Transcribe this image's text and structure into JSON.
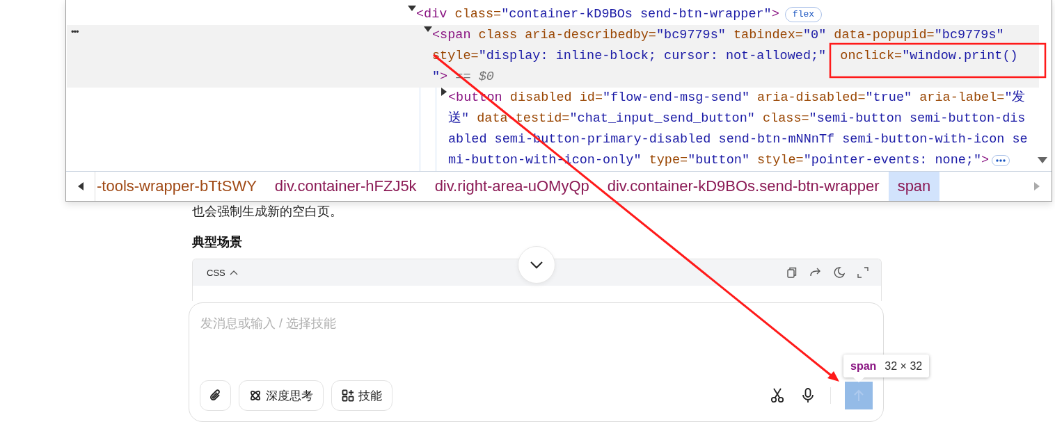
{
  "devtools": {
    "more_label": "•••",
    "tree": [
      {
        "expanded": true,
        "selected": false,
        "badge": "flex",
        "lines": [
          [
            {
              "kind": "tag",
              "text": "<div"
            },
            {
              "kind": "attr",
              "text": " class="
            },
            {
              "kind": "value",
              "text": "\"container-kD9BOs send-btn-wrapper\""
            },
            {
              "kind": "tag",
              "text": ">"
            }
          ]
        ],
        "children": [
          {
            "expanded": true,
            "selected": true,
            "lines": [
              [
                {
                  "kind": "tag",
                  "text": "<span"
                },
                {
                  "kind": "attr",
                  "text": " class aria-describedby="
                },
                {
                  "kind": "value",
                  "text": "\"bc9779s\""
                },
                {
                  "kind": "attr",
                  "text": " tabindex="
                },
                {
                  "kind": "value",
                  "text": "\"0\""
                },
                {
                  "kind": "attr",
                  "text": " data-popupid="
                },
                {
                  "kind": "value",
                  "text": "\"bc9779s\""
                }
              ],
              [
                {
                  "kind": "attr",
                  "text": "style="
                },
                {
                  "kind": "value",
                  "text": "\"display: inline-block; cursor: not-allowed;\""
                },
                {
                  "kind": "attr",
                  "text": " onclick=",
                  "split": true
                },
                {
                  "kind": "value",
                  "text": "\"window.print()"
                }
              ],
              [
                {
                  "kind": "value",
                  "text": "\""
                },
                {
                  "kind": "tag",
                  "text": ">"
                },
                {
                  "kind": "hint",
                  "text": " == $0"
                }
              ]
            ],
            "children": [
              {
                "expanded": false,
                "selected": false,
                "ellipsis": true,
                "lines": [
                  [
                    {
                      "kind": "tag",
                      "text": "<button"
                    },
                    {
                      "kind": "attr",
                      "text": " disabled id="
                    },
                    {
                      "kind": "value",
                      "text": "\"flow-end-msg-send\""
                    },
                    {
                      "kind": "attr",
                      "text": " aria-disabled="
                    },
                    {
                      "kind": "value",
                      "text": "\"true\""
                    },
                    {
                      "kind": "attr",
                      "text": " aria-label="
                    },
                    {
                      "kind": "value",
                      "text": "\"发"
                    }
                  ],
                  [
                    {
                      "kind": "value",
                      "text": "送\""
                    },
                    {
                      "kind": "attr",
                      "text": " data-testid="
                    },
                    {
                      "kind": "value",
                      "text": "\"chat_input_send_button\""
                    },
                    {
                      "kind": "attr",
                      "text": " class="
                    },
                    {
                      "kind": "value",
                      "text": "\"semi-button semi-button-dis"
                    }
                  ],
                  [
                    {
                      "kind": "value",
                      "text": "abled semi-button-primary-disabled send-btn-mNNnTf semi-button-with-icon se"
                    }
                  ],
                  [
                    {
                      "kind": "value",
                      "text": "mi-button-with-icon-only\""
                    },
                    {
                      "kind": "attr",
                      "text": " type="
                    },
                    {
                      "kind": "value",
                      "text": "\"button\""
                    },
                    {
                      "kind": "attr",
                      "text": " style="
                    },
                    {
                      "kind": "value",
                      "text": "\"pointer-events: none;\""
                    },
                    {
                      "kind": "tag",
                      "text": ">"
                    }
                  ]
                ]
              }
            ]
          }
        ]
      }
    ],
    "breadcrumbs": [
      {
        "text": "-tools-wrapper-bTtSWY",
        "kind": "partial",
        "selected": false
      },
      {
        "text": "div.container-hFZJ5k",
        "kind": "full",
        "selected": false
      },
      {
        "text": "div.right-area-uOMyQp",
        "kind": "full",
        "selected": false
      },
      {
        "text": "div.container-kD9BOs.send-btn-wrapper",
        "kind": "full",
        "selected": false
      },
      {
        "text": "span",
        "kind": "full",
        "selected": true
      }
    ]
  },
  "page": {
    "paragraph": "也会强制生成新的空白页。",
    "heading": "典型场景",
    "code_block": {
      "language": "CSS",
      "expanded": true
    },
    "input": {
      "placeholder": "发消息或输入 / 选择技能"
    },
    "tools": [
      {
        "kind": "attach"
      },
      {
        "kind": "think",
        "label": "深度思考"
      },
      {
        "kind": "skills",
        "label": "技能"
      }
    ],
    "send": {
      "disabled": true,
      "highlighted": true
    },
    "inspector_tooltip": {
      "tag": "span",
      "size": "32 × 32"
    }
  }
}
